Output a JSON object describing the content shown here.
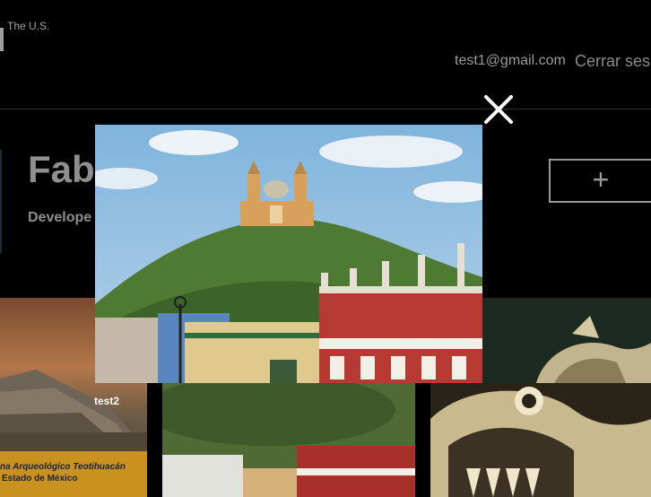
{
  "header": {
    "tagline": "The U.S.",
    "user_email": "test1@gmail.com",
    "logout_label": "Cerrar ses"
  },
  "profile": {
    "name": "Fab",
    "role": "Develope"
  },
  "actions": {
    "add_glyph": "+"
  },
  "gallery": {
    "tiles": [
      {
        "caption_line1": "na Arqueológico Teotihuacán",
        "caption_line2": "Estado de México"
      },
      {
        "label": "test2"
      }
    ]
  },
  "modal": {
    "close_glyph": "×"
  },
  "colors": {
    "background": "#000000",
    "text_muted": "#9a9a9a",
    "caption_bg": "#c9921f"
  }
}
